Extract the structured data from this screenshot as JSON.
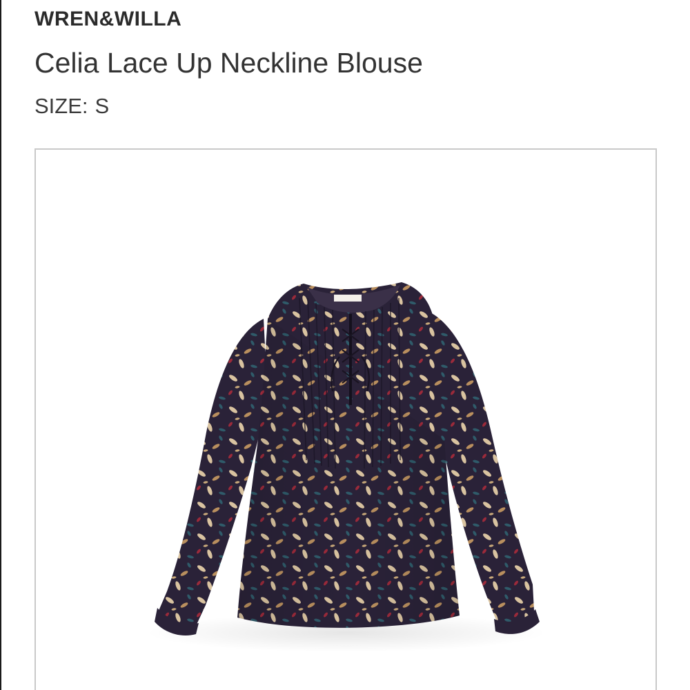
{
  "product": {
    "brand": "WREN&WILLA",
    "name": "Celia Lace Up Neckline Blouse",
    "size_label": "SIZE:",
    "size_value": "S"
  },
  "image": {
    "icon": "blouse-photo",
    "colors": {
      "fabric": "#2a2238",
      "leaf_light": "#d9c3a0",
      "leaf_tan": "#b98f5e",
      "leaf_teal": "#2f5b6a",
      "leaf_red": "#9b2a3a",
      "frame_border": "#c9c9c9"
    }
  }
}
